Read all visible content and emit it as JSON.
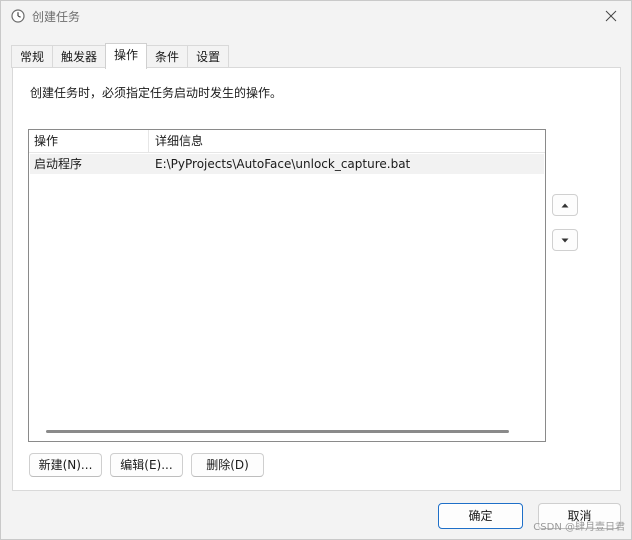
{
  "window": {
    "title": "创建任务",
    "icon": "clock-icon",
    "close_icon": "close-icon"
  },
  "tabs": [
    {
      "label": "常规",
      "active": false
    },
    {
      "label": "触发器",
      "active": false
    },
    {
      "label": "操作",
      "active": true
    },
    {
      "label": "条件",
      "active": false
    },
    {
      "label": "设置",
      "active": false
    }
  ],
  "panel": {
    "description": "创建任务时，必须指定任务启动时发生的操作。",
    "columns": [
      "操作",
      "详细信息"
    ],
    "rows": [
      {
        "action": "启动程序",
        "detail": "E:\\PyProjects\\AutoFace\\unlock_capture.bat"
      }
    ],
    "move_up_icon": "triangle-up-icon",
    "move_down_icon": "triangle-down-icon",
    "buttons": {
      "new": "新建(N)...",
      "edit": "编辑(E)...",
      "delete": "删除(D)"
    }
  },
  "footer": {
    "ok": "确定",
    "cancel": "取消"
  },
  "watermark": "CSDN @肆月壹日君",
  "colors": {
    "accent_border": "#1e6fc8",
    "background": "#f3f3f3",
    "selected_row": "#f2f2f2"
  }
}
